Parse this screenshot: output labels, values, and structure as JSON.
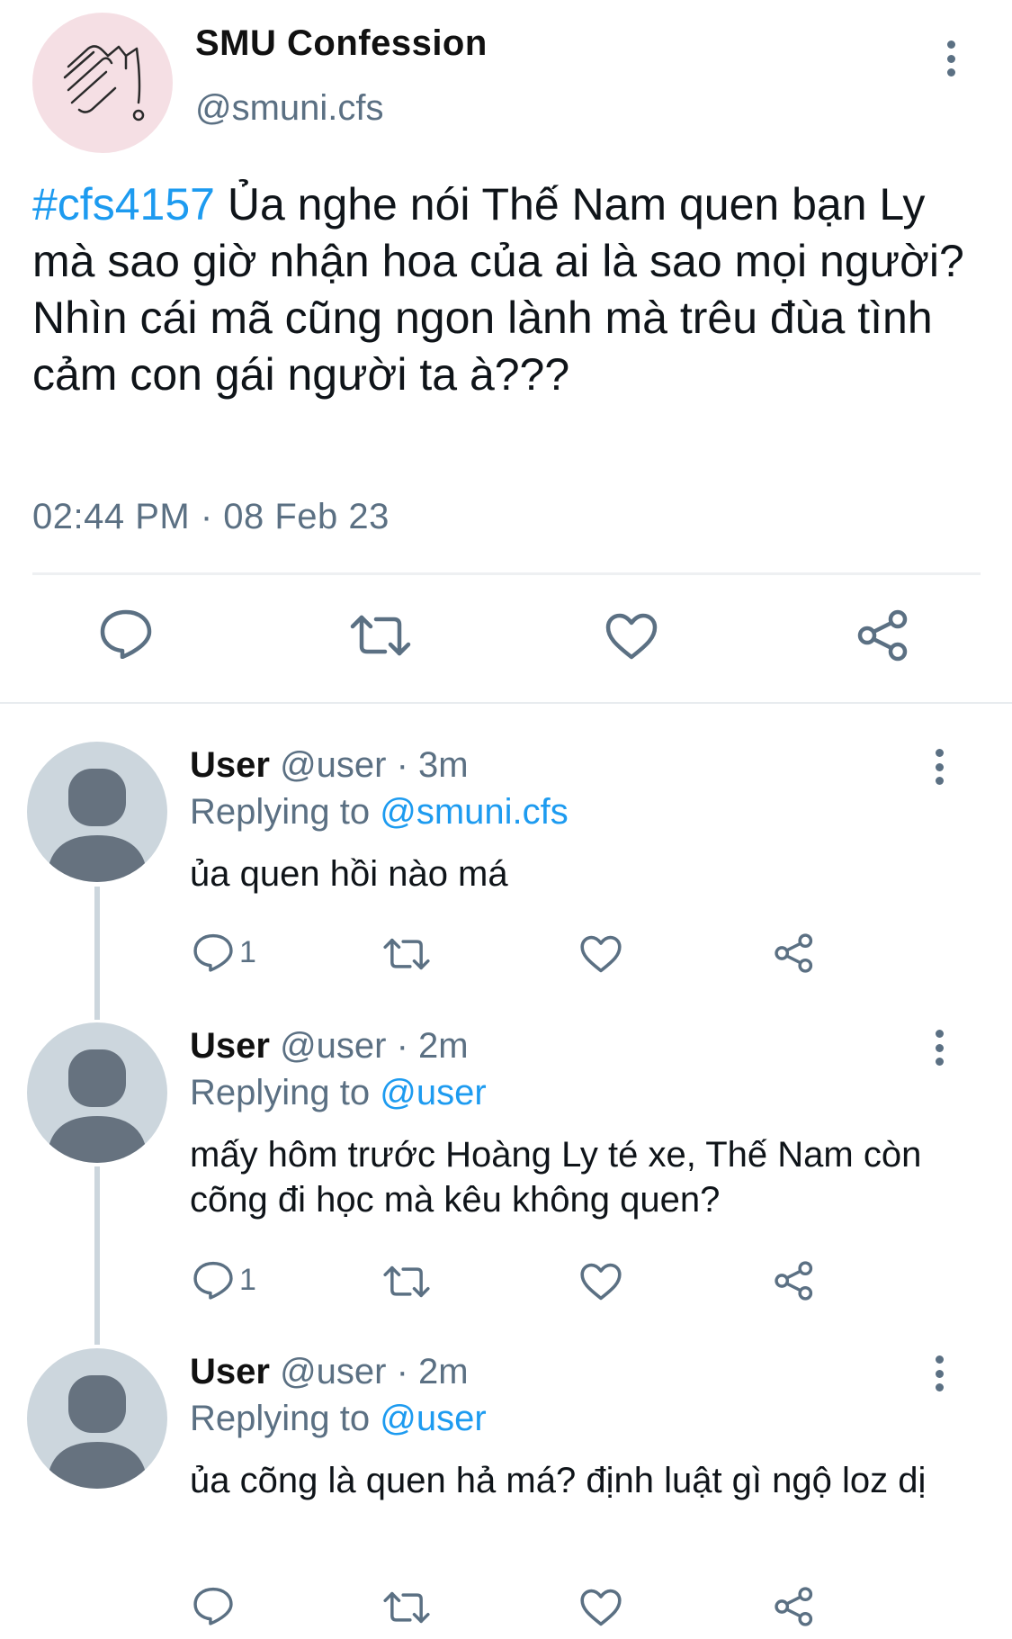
{
  "tweet": {
    "display_name": "SMU Confession",
    "handle": "@smuni.cfs",
    "hashtag": "#cfs4157",
    "body": " Ủa nghe nói Thế Nam quen bạn Ly mà sao giờ nhận hoa của ai là sao mọi người? Nhìn cái mã cũng ngon lành mà trêu đùa tình cảm con gái người ta à???",
    "timestamp": "02:44 PM · 08 Feb 23"
  },
  "icons": {
    "more": "more-vertical-icon",
    "reply": "speech-bubble-icon",
    "retweet": "retweet-icon",
    "like": "heart-icon",
    "share": "share-icon",
    "avatar": "default-user-avatar-icon",
    "logo": "sm-logo-icon"
  },
  "colors": {
    "accent": "#1d9bf0",
    "muted": "#5b7083",
    "avatar_bg": "#ccd6dd",
    "avatar_fg": "#66727f",
    "logo_bg": "#f5dfe4"
  },
  "replies": [
    {
      "name": "User",
      "meta": " @user · 3m",
      "replying_prefix": "Replying to ",
      "replying_to": "@smuni.cfs",
      "text": "ủa quen hồi nào má",
      "reply_count": "1"
    },
    {
      "name": "User",
      "meta": " @user · 2m",
      "replying_prefix": "Replying to ",
      "replying_to": "@user",
      "text": "mấy hôm trước Hoàng Ly té xe, Thế Nam còn cõng đi học mà kêu không quen?",
      "reply_count": "1"
    },
    {
      "name": "User",
      "meta": " @user · 2m",
      "replying_prefix": "Replying to ",
      "replying_to": "@user",
      "text": "ủa cõng là quen hả má? định luật gì ngộ loz dị",
      "reply_count": ""
    }
  ]
}
